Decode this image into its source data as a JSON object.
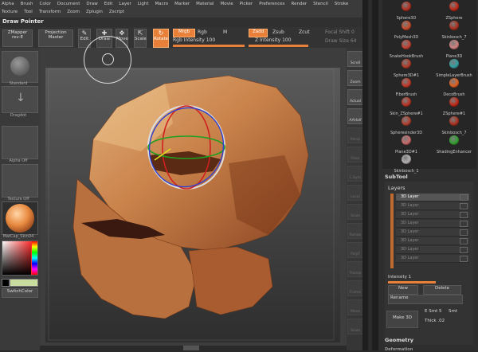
{
  "menu": {
    "row1": [
      "Alpha",
      "Brush",
      "Color",
      "Document",
      "Draw",
      "Edit",
      "Layer",
      "Light",
      "Macro",
      "Marker",
      "Material",
      "Movie",
      "Picker",
      "Preferences",
      "Render",
      "Stencil",
      "Stroke"
    ],
    "row2": [
      "Texture",
      "Tool",
      "Transform",
      "Zoom",
      "Zplugin",
      "Zscript"
    ]
  },
  "title": "Draw Pointer",
  "shelf": {
    "zmapper": "ZMapper rev-E",
    "projection": "Projection Master",
    "edit": "Edit",
    "draw": "Draw",
    "move": "Move",
    "scale": "Scale",
    "rotate": "Rotate",
    "mrgb": "Mrgb",
    "rgb": "Rgb",
    "m": "M",
    "rgb_intensity_label": "Rgb Intensity",
    "rgb_intensity": "100",
    "zadd": "Zadd",
    "zsub": "Zsub",
    "zcut": "Zcut",
    "z_intensity_label": "Z Intensity",
    "z_intensity": "100",
    "focal_shift": "Focal Shift",
    "focal_shift_val": "0",
    "draw_size": "Draw Size",
    "draw_size_val": "64"
  },
  "left": {
    "brush_label": "Standard",
    "stroke_label": "Dragdot",
    "alpha_label": "Alpha Off",
    "texture_label": "Texture Off",
    "material_label": "MatCap_Skin04",
    "switch_color": "SwitchColor"
  },
  "right_buttons": [
    "Scroll",
    "Zoom",
    "Actual",
    "AAHalf",
    "Persp",
    "Floor",
    "L.Sym",
    "Local",
    "Scale",
    "Rotate",
    "PolyF",
    "Transp",
    "Frame",
    "Move",
    "Scale"
  ],
  "tools": [
    {
      "name": "Sphere3D",
      "color": "#b03020"
    },
    {
      "name": "ZSphere",
      "color": "#c02818"
    },
    {
      "name": "PolyMesh3D",
      "color": "#c64a2a"
    },
    {
      "name": "Skinbosch_7",
      "color": "#a83020"
    },
    {
      "name": "SnakeHookBrush",
      "color": "#c04030"
    },
    {
      "name": "Plane3D",
      "color": "#d08080"
    },
    {
      "name": "Sphere3D#1",
      "color": "#b03a28"
    },
    {
      "name": "SimpleLayerBrush",
      "color": "#30a0a0"
    },
    {
      "name": "FiberBrush",
      "color": "#c03828"
    },
    {
      "name": "DecoBrush",
      "color": "#e06020"
    },
    {
      "name": "Skin_ZSphere#1",
      "color": "#b83424"
    },
    {
      "name": "ZSphere#1",
      "color": "#c02818"
    },
    {
      "name": "Spheresinder3D",
      "color": "#b04030"
    },
    {
      "name": "Skinbosch_7",
      "color": "#a83020"
    },
    {
      "name": "Plane3D#1",
      "color": "#c86a6a"
    },
    {
      "name": "ShadingEnhancer",
      "color": "#30a030"
    },
    {
      "name": "Skinbosch_1",
      "color": "#b0b0b0"
    }
  ],
  "tray": {
    "subtool": "SubTool",
    "layers": "Layers",
    "layer_items": [
      "3D Layer",
      "3D Layer",
      "3D Layer",
      "3D Layer",
      "3D Layer",
      "3D Layer",
      "3D Layer",
      "3D Layer"
    ],
    "intensity": "Intensity 1",
    "new": "New",
    "delete": "Delete",
    "rename": "Rename",
    "make3d": "Make 3D",
    "esmt": "E Smt",
    "esmt_val": "5",
    "smt": "Smt",
    "thick": "Thick",
    "thick_val": ".02",
    "geometry": "Geometry",
    "deformation": "Deformation"
  },
  "colors": {
    "accent": "#e8803a",
    "skin": "#c07040"
  }
}
